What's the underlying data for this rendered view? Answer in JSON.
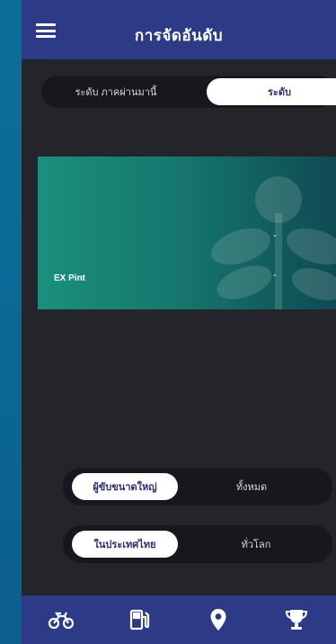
{
  "header": {
    "title": "การจัดอันดับ"
  },
  "tabs": [
    {
      "label": "ระดับ ภาคผ่านมานี้",
      "active": false
    },
    {
      "label": "ระดับ",
      "active": true
    }
  ],
  "card": {
    "name": "EX Pint",
    "value_top": "-",
    "value_bottom": "-"
  },
  "filter_a": [
    {
      "label": "ผู้ขับขนาดใหญ่",
      "active": true
    },
    {
      "label": "ทั้งหมด",
      "active": false
    }
  ],
  "filter_b": [
    {
      "label": "ในประเทศไทย",
      "active": true
    },
    {
      "label": "ทั่วโลก",
      "active": false
    }
  ],
  "bottom_nav": [
    {
      "icon": "motorcycle-icon",
      "active": false
    },
    {
      "icon": "fuel-pump-icon",
      "active": false
    },
    {
      "icon": "location-pin-icon",
      "active": false
    },
    {
      "icon": "trophy-icon",
      "active": true
    }
  ],
  "colors": {
    "header_bg": "#2d3a86",
    "body_bg": "#23252b",
    "card_start": "#1b8f7d",
    "card_end": "#0f4a52"
  }
}
